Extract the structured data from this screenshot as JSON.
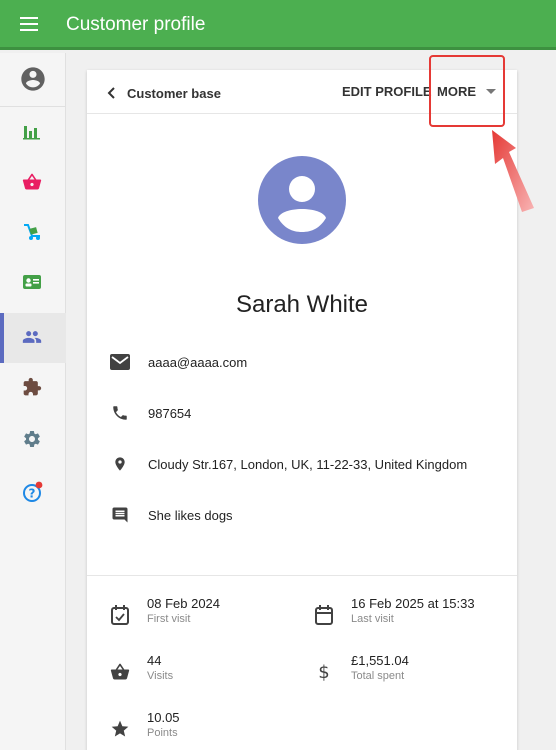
{
  "appbar": {
    "title": "Customer profile"
  },
  "header": {
    "back_label": "Customer base",
    "edit_label": "EDIT PROFILE",
    "more_label": "MORE"
  },
  "customer": {
    "name": "Sarah White",
    "email": "aaaa@aaaa.com",
    "phone": "987654",
    "address": "Cloudy Str.167, London, UK, 11-22-33, United Kingdom",
    "note": "She likes dogs"
  },
  "stats": {
    "first_visit": {
      "value": "08 Feb 2024",
      "label": "First visit"
    },
    "last_visit": {
      "value": "16 Feb 2025 at 15:33",
      "label": "Last visit"
    },
    "visits": {
      "value": "44",
      "label": "Visits"
    },
    "total_spent": {
      "value": "£1,551.04",
      "label": "Total spent"
    },
    "points": {
      "value": "10.05",
      "label": "Points"
    }
  },
  "colors": {
    "appbar": "#4caf50",
    "avatar": "#7986cb",
    "active_nav": "#5c6bc0",
    "highlight": "#e53935"
  },
  "sidebar": {
    "items": [
      {
        "name": "analytics",
        "icon": "bar-chart-icon",
        "color": "#43a047"
      },
      {
        "name": "sales",
        "icon": "basket-icon",
        "color": "#e91e63"
      },
      {
        "name": "inventory",
        "icon": "dolly-icon",
        "color": "#03a9f4"
      },
      {
        "name": "employees",
        "icon": "badge-icon",
        "color": "#43a047"
      },
      {
        "name": "customers",
        "icon": "people-icon",
        "color": "#5c6bc0",
        "active": true
      },
      {
        "name": "apps",
        "icon": "puzzle-icon",
        "color": "#6d4c41"
      },
      {
        "name": "settings",
        "icon": "gear-icon",
        "color": "#607d8b"
      },
      {
        "name": "help",
        "icon": "help-icon",
        "color": "#1e88e5"
      }
    ]
  }
}
